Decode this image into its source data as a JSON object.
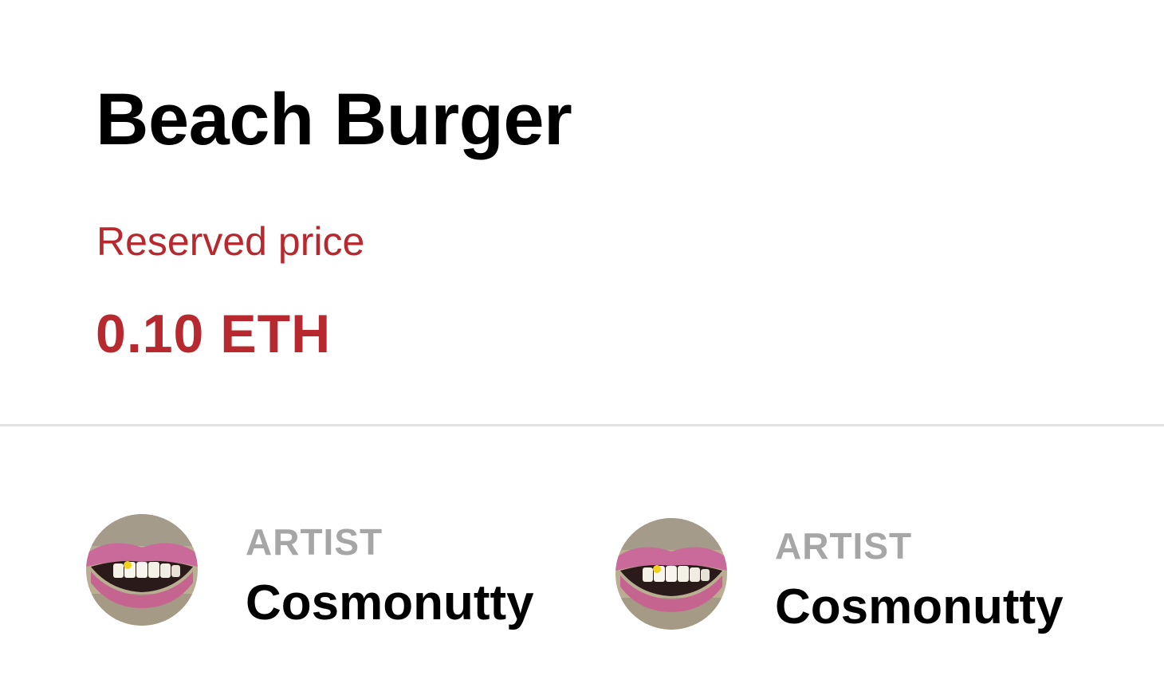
{
  "artwork": {
    "title": "Beach Burger"
  },
  "pricing": {
    "label": "Reserved price",
    "value": "0.10 ETH",
    "accent_color": "#b8282f"
  },
  "artists": [
    {
      "role": "ARTIST",
      "name": "Cosmonutty",
      "avatar_icon": "lips-avatar"
    },
    {
      "role": "ARTIST",
      "name": "Cosmonutty",
      "avatar_icon": "lips-avatar"
    }
  ]
}
